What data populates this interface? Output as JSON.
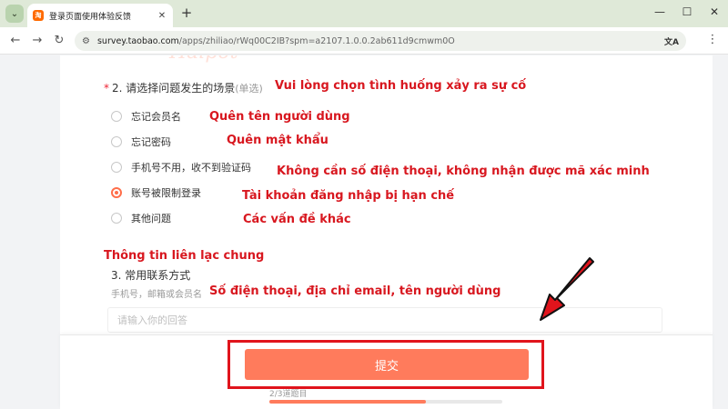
{
  "browser": {
    "tab_title": "登录页面使用体验反馈",
    "favicon_text": "淘",
    "close_glyph": "✕",
    "new_tab_glyph": "+",
    "menu_glyph": "⌄",
    "minimize_glyph": "—",
    "maximize_glyph": "☐",
    "window_close_glyph": "✕",
    "back_glyph": "←",
    "forward_glyph": "→",
    "reload_glyph": "↻",
    "site_info_glyph": "⚙",
    "url_domain": "survey.taobao.com",
    "url_path": "/apps/zhiliao/rWq00C2IB?spm=a2107.1.0.0.2ab611d9cmwm0O",
    "translate_glyph": "文A",
    "kebab_glyph": "⋮"
  },
  "page": {
    "watermark": "Haipot",
    "question2": {
      "required_mark": "*",
      "title": "2. 请选择问题发生的场景",
      "hint": "(单选)",
      "options": [
        {
          "label": "忘记会员名",
          "checked": false
        },
        {
          "label": "忘记密码",
          "checked": false
        },
        {
          "label": "手机号不用，收不到验证码",
          "checked": false
        },
        {
          "label": "账号被限制登录",
          "checked": true
        },
        {
          "label": "其他问题",
          "checked": false
        }
      ]
    },
    "question3": {
      "title": "3. 常用联系方式",
      "hint": "手机号，邮箱或会员名",
      "placeholder": "请输入你的回答"
    },
    "submit_label": "提交",
    "progress": {
      "text": "2/3道题目",
      "fraction": 0.67
    }
  },
  "annotations": {
    "q2_note": "Vui lòng chọn tình huống xảy ra sự cố",
    "opt1_note": "Quên tên người dùng",
    "opt2_note": "Quên mật khẩu",
    "opt3_note": "Không cần số điện thoại, không nhận được mã xác minh",
    "opt4_note": "Tài khoản đăng nhập bị hạn chế",
    "opt5_note": "Các vấn đề khác",
    "section_note": "Thông tin liên lạc chung",
    "q3_note": "Số điện thoại, địa chỉ email, tên người dùng"
  },
  "colors": {
    "accent": "#ff7b5c",
    "annotation_red": "#d8171f"
  }
}
